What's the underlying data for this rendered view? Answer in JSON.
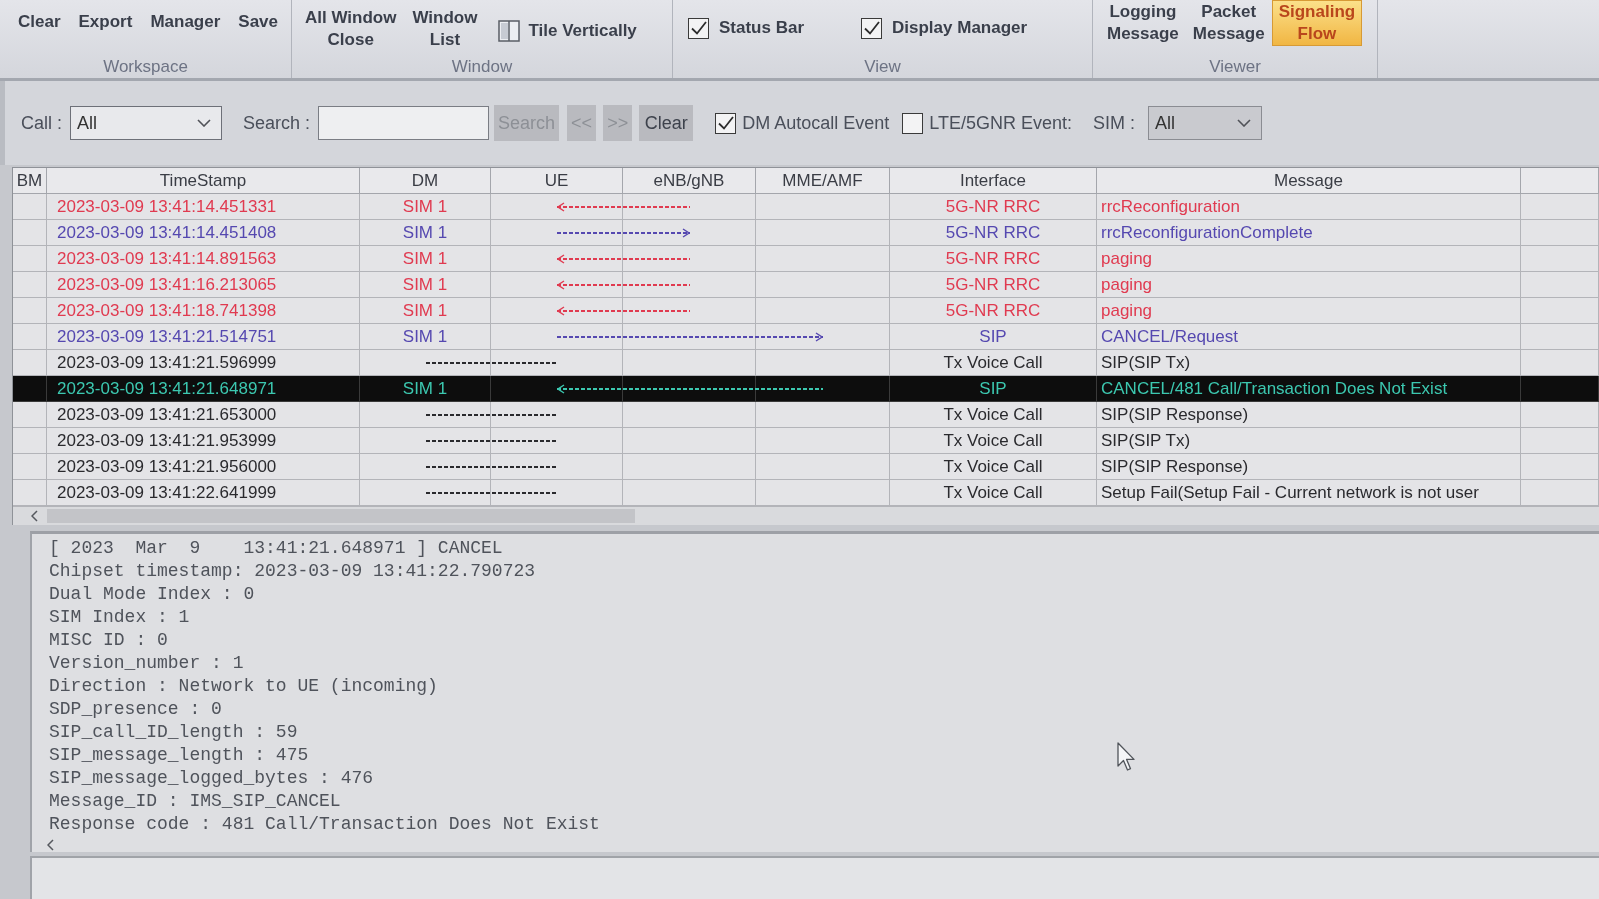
{
  "ribbon": {
    "groups": [
      {
        "label": "Workspace",
        "items": [
          {
            "kind": "large",
            "label": "Clear"
          },
          {
            "kind": "large",
            "label": "Export"
          },
          {
            "kind": "large",
            "label": "Manager"
          },
          {
            "kind": "large",
            "label": "Save"
          }
        ]
      },
      {
        "label": "Window",
        "items": [
          {
            "kind": "large",
            "label": "All Window\nClose"
          },
          {
            "kind": "large",
            "label": "Window\nList"
          },
          {
            "kind": "small",
            "label": "Tile Vertically"
          }
        ]
      },
      {
        "label": "View",
        "items": [
          {
            "kind": "checkbox",
            "label": "Status Bar",
            "checked": true
          },
          {
            "kind": "checkbox",
            "label": "Display Manager",
            "checked": true
          }
        ]
      },
      {
        "label": "Viewer",
        "items": [
          {
            "kind": "large",
            "label": "Logging\nMessage",
            "selected": false
          },
          {
            "kind": "large",
            "label": "Packet\nMessage",
            "selected": false
          },
          {
            "kind": "large",
            "label": "Signaling\nFlow",
            "selected": true
          }
        ]
      }
    ]
  },
  "filters": {
    "call": {
      "label": "Call :",
      "value": "All"
    },
    "search": {
      "label": "Search :"
    },
    "buttons": [
      {
        "label": "Search",
        "disabled": true
      },
      {
        "label": "<<",
        "disabled": true
      },
      {
        "label": ">>",
        "disabled": true
      },
      {
        "label": "Clear",
        "disabled": false
      }
    ],
    "checkboxes": [
      {
        "label": "DM Autocall Event",
        "checked": true
      },
      {
        "label": "LTE/5GNR Event:",
        "checked": false
      }
    ],
    "sim": {
      "label": "SIM :",
      "value": "All"
    }
  },
  "table": {
    "columns": [
      "BM",
      "TimeStamp",
      "DM",
      "UE",
      "eNB/gNB",
      "MME/AMF",
      "Interface",
      "Message"
    ],
    "rows": [
      {
        "timestamp": "2023-03-09 13:41:14.451331",
        "dm": "SIM 1",
        "kind": "downlink",
        "reaches_core": false,
        "interface": "5G-NR RRC",
        "message": "rrcReconfiguration",
        "color": "#e03a50",
        "selected": false
      },
      {
        "timestamp": "2023-03-09 13:41:14.451408",
        "dm": "SIM 1",
        "kind": "uplink",
        "reaches_core": false,
        "interface": "5G-NR RRC",
        "message": "rrcReconfigurationComplete",
        "color": "#5548b0",
        "selected": false
      },
      {
        "timestamp": "2023-03-09 13:41:14.891563",
        "dm": "SIM 1",
        "kind": "downlink",
        "reaches_core": false,
        "interface": "5G-NR RRC",
        "message": "paging",
        "color": "#e03a50",
        "selected": false
      },
      {
        "timestamp": "2023-03-09 13:41:16.213065",
        "dm": "SIM 1",
        "kind": "downlink",
        "reaches_core": false,
        "interface": "5G-NR RRC",
        "message": "paging",
        "color": "#e03a50",
        "selected": false
      },
      {
        "timestamp": "2023-03-09 13:41:18.741398",
        "dm": "SIM 1",
        "kind": "downlink",
        "reaches_core": false,
        "interface": "5G-NR RRC",
        "message": "paging",
        "color": "#e03a50",
        "selected": false
      },
      {
        "timestamp": "2023-03-09 13:41:21.514751",
        "dm": "SIM 1",
        "kind": "uplink",
        "reaches_core": true,
        "interface": "SIP",
        "message": "CANCEL/Request",
        "color": "#5548b0",
        "selected": false
      },
      {
        "timestamp": "2023-03-09 13:41:21.596999",
        "kind": "internal",
        "interface": "Tx Voice Call",
        "message": "SIP(SIP Tx)",
        "color": "#2a2a2e",
        "selected": false
      },
      {
        "timestamp": "2023-03-09 13:41:21.648971",
        "dm": "SIM 1",
        "kind": "downlink",
        "reaches_core": true,
        "interface": "SIP",
        "message": "CANCEL/481 Call/Transaction Does Not Exist",
        "selected": true
      },
      {
        "timestamp": "2023-03-09 13:41:21.653000",
        "kind": "internal",
        "interface": "Tx Voice Call",
        "message": "SIP(SIP Response)",
        "color": "#2a2a2e",
        "selected": false
      },
      {
        "timestamp": "2023-03-09 13:41:21.953999",
        "kind": "internal",
        "interface": "Tx Voice Call",
        "message": "SIP(SIP Tx)",
        "color": "#2a2a2e",
        "selected": false
      },
      {
        "timestamp": "2023-03-09 13:41:21.956000",
        "kind": "internal",
        "interface": "Tx Voice Call",
        "message": "SIP(SIP Response)",
        "color": "#2a2a2e",
        "selected": false
      },
      {
        "timestamp": "2023-03-09 13:41:22.641999",
        "kind": "internal",
        "interface": "Tx Voice Call",
        "message": "Setup Fail(Setup Fail - Current network is not user",
        "color": "#2a2a2e",
        "selected": false
      }
    ]
  },
  "detail": {
    "lines": [
      "[ 2023  Mar  9    13:41:21.648971 ] CANCEL",
      "Chipset timestamp: 2023-03-09 13:41:22.790723",
      "Dual Mode Index : 0",
      "SIM Index : 1",
      "MISC ID : 0",
      "Version_number : 1",
      "Direction : Network to UE (incoming)",
      "SDP_presence : 0",
      "SIP_call_ID_length : 59",
      "SIP_message_length : 475",
      "SIP_message_logged_bytes : 476",
      "Message_ID : IMS_SIP_CANCEL",
      "Response code : 481 Call/Transaction Does Not Exist"
    ]
  }
}
